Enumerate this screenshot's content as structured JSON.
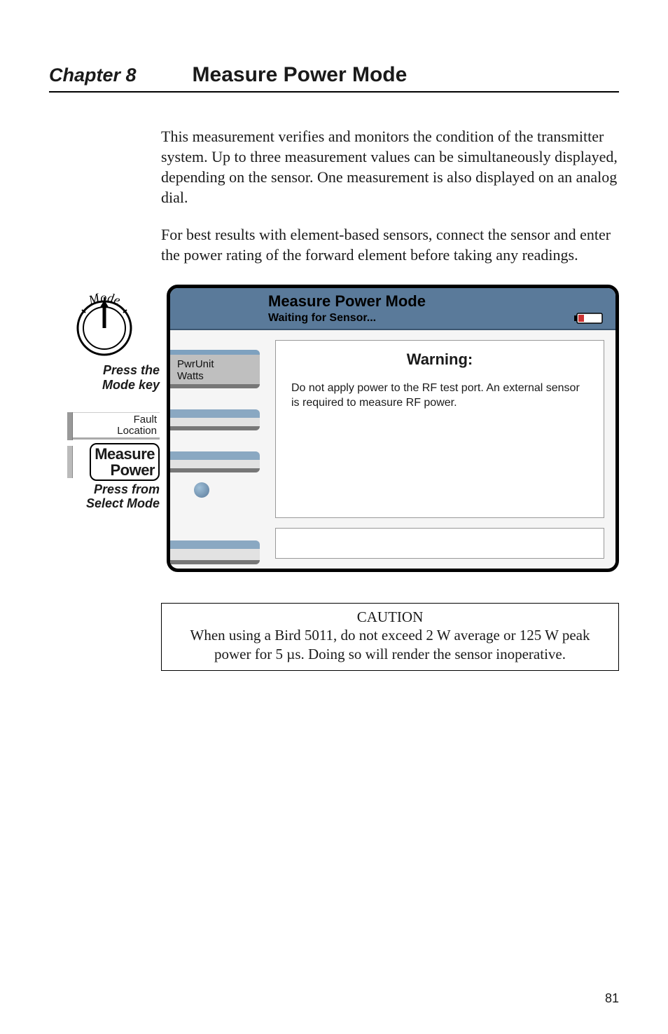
{
  "chapter": {
    "label": "Chapter 8",
    "title": "Measure Power Mode"
  },
  "paragraphs": {
    "p1": "This measurement verifies and monitors the condition of the transmitter system. Up to three measurement values can be simultaneously displayed, depending on the sensor. One measurement is also displayed on an analog dial.",
    "p2": "For best results with element-based sensors, connect the sensor and enter the power rating of the forward element before taking any readings."
  },
  "left": {
    "dial_arc_label": "Mode",
    "press_mode": "Press the\nMode key",
    "tab_fault": "Fault",
    "tab_location": "Location",
    "button_line1": "Measure",
    "button_line2": "Power",
    "press_from": "Press from\nSelect Mode"
  },
  "screen": {
    "title": "Measure Power Mode",
    "subtitle": "Waiting for Sensor...",
    "softkey1_line1": "PwrUnit",
    "softkey1_line2": "Watts",
    "warning_title": "Warning:",
    "warning_body": "Do not apply power to the RF test port. An external sensor is required to measure RF power."
  },
  "caution": {
    "title": "CAUTION",
    "body": "When using a Bird 5011, do not exceed 2 W average or 125 W peak power for 5 µs. Doing so will render the sensor inoperative."
  },
  "page_number": "81"
}
